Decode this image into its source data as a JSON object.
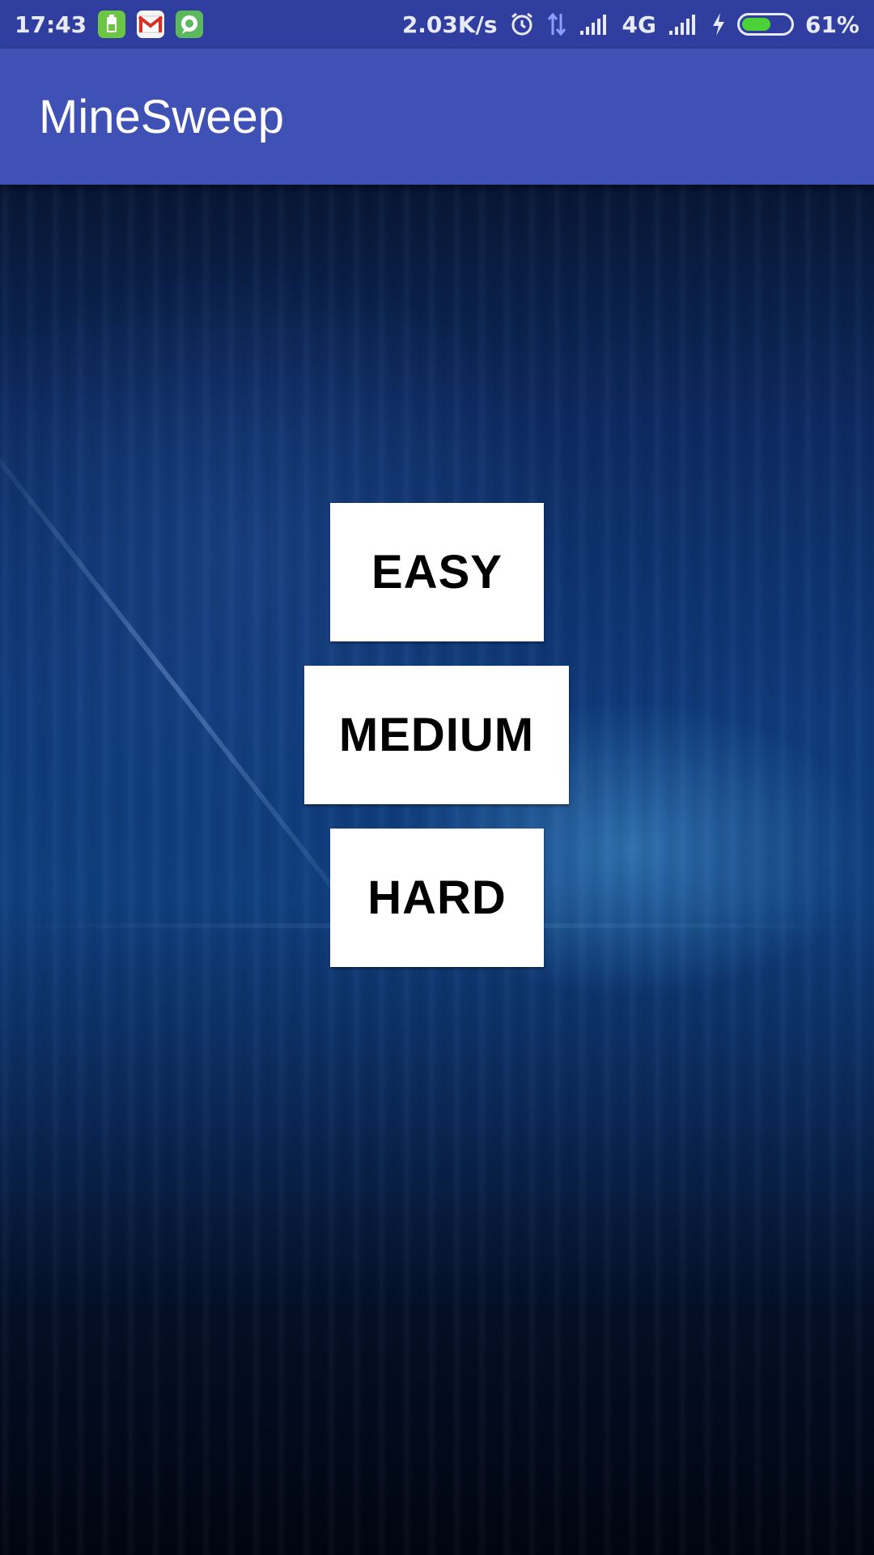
{
  "status_bar": {
    "time": "17:43",
    "network_speed": "2.03K/s",
    "network_type": "4G",
    "battery_percent": "61%",
    "battery_level": 0.61,
    "notification_icons": [
      "battery-app-icon",
      "gmail-icon",
      "chat-app-icon"
    ],
    "system_icons": [
      "alarm-icon",
      "data-transfer-icon",
      "signal-icon",
      "signal-icon-2",
      "charging-icon",
      "battery-icon"
    ]
  },
  "app_bar": {
    "title": "MineSweep",
    "color": "#3f51b5"
  },
  "menu": {
    "buttons": [
      {
        "label": "EASY"
      },
      {
        "label": "MEDIUM"
      },
      {
        "label": "HARD"
      }
    ]
  },
  "colors": {
    "status_bar": "#303f9f",
    "app_bar": "#3f51b5",
    "button_bg": "#ffffff",
    "button_text": "#000000"
  }
}
